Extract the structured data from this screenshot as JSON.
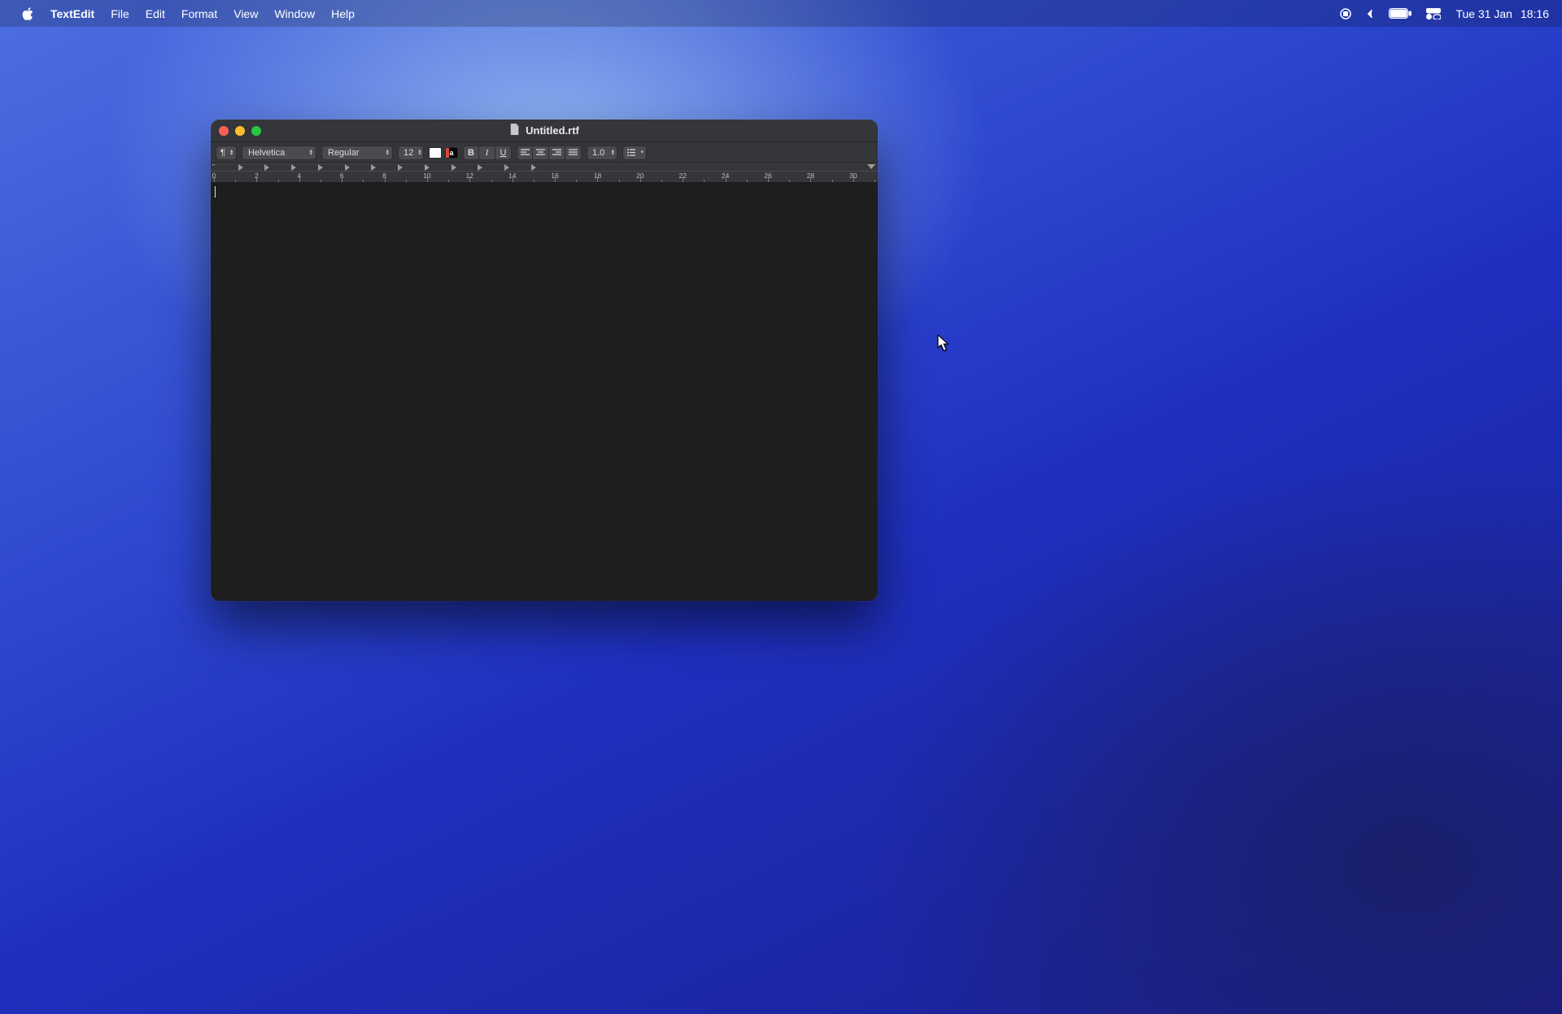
{
  "menubar": {
    "app_name": "TextEdit",
    "items": [
      "File",
      "Edit",
      "Format",
      "View",
      "Window",
      "Help"
    ],
    "clock_date": "Tue 31 Jan",
    "clock_time": "18:16"
  },
  "window": {
    "title": "Untitled.rtf",
    "toolbar": {
      "paragraph_symbol": "¶",
      "font_family": "Helvetica",
      "font_style": "Regular",
      "font_size": "12",
      "bold": "B",
      "italic": "I",
      "underline": "U",
      "line_spacing": "1.0",
      "text_color_letter": "a",
      "fill_color": "#ffffff",
      "text_accent_color": "#e0453b"
    },
    "ruler": {
      "labels": [
        "0",
        "2",
        "4",
        "6",
        "8",
        "10",
        "12",
        "14",
        "16",
        "18",
        "20",
        "22",
        "24",
        "26",
        "28",
        "30"
      ],
      "tab_count": 12
    }
  }
}
